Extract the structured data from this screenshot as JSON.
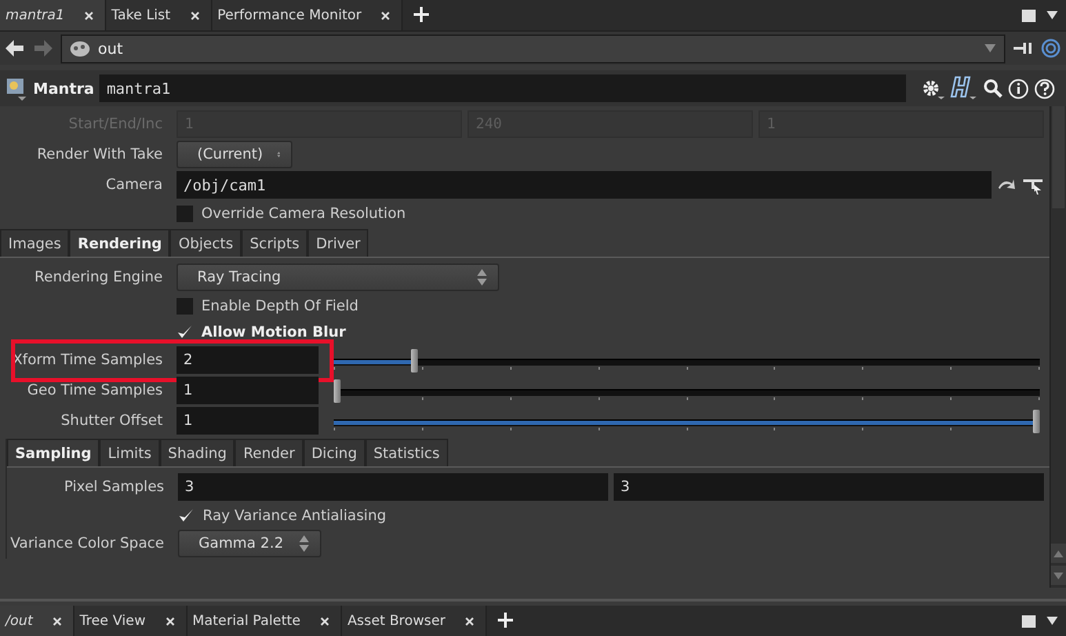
{
  "pane_tabs": [
    {
      "label": "mantra1",
      "selected": true
    },
    {
      "label": "Take List",
      "selected": false
    },
    {
      "label": "Performance Monitor",
      "selected": false
    }
  ],
  "path": {
    "value": "out"
  },
  "node": {
    "type": "Mantra",
    "name": "mantra1"
  },
  "top_parms": [
    {
      "kind": "triple",
      "label": "Start/End/Inc",
      "disabled": true,
      "values": [
        "1",
        "240",
        "1"
      ]
    },
    {
      "kind": "menu",
      "label": "Render With Take",
      "disabled": false,
      "value": "(Current)"
    },
    {
      "kind": "text",
      "label": "Camera",
      "disabled": false,
      "value": "/obj/cam1"
    },
    {
      "kind": "toggle",
      "label": "Override Camera Resolution",
      "disabled": false,
      "checked": false,
      "modified": false
    }
  ],
  "tabs": [
    {
      "label": "Images",
      "selected": false
    },
    {
      "label": "Rendering",
      "selected": true
    },
    {
      "label": "Objects",
      "selected": false
    },
    {
      "label": "Scripts",
      "selected": false
    },
    {
      "label": "Driver",
      "selected": false
    }
  ],
  "rendering_parms": [
    {
      "kind": "menu",
      "label": "Rendering Engine",
      "value": "Ray Tracing"
    },
    {
      "kind": "toggle",
      "label": "Enable Depth Of Field",
      "checked": false,
      "modified": false
    },
    {
      "kind": "toggle",
      "label": "Allow Motion Blur",
      "checked": true,
      "modified": true
    },
    {
      "kind": "slider",
      "label": "Xform Time Samples",
      "value": "2",
      "level": 0.11,
      "highlighted": true
    },
    {
      "kind": "slider",
      "label": "Geo Time Samples",
      "value": "1",
      "level": 0,
      "highlighted": false
    },
    {
      "kind": "slider",
      "label": "Shutter Offset",
      "value": "1",
      "level": 1,
      "highlighted": false
    }
  ],
  "sub_tabs": [
    {
      "label": "Sampling",
      "selected": true
    },
    {
      "label": "Limits",
      "selected": false
    },
    {
      "label": "Shading",
      "selected": false
    },
    {
      "label": "Render",
      "selected": false
    },
    {
      "label": "Dicing",
      "selected": false
    },
    {
      "label": "Statistics",
      "selected": false
    }
  ],
  "sampling_parms": [
    {
      "kind": "pair",
      "label": "Pixel Samples",
      "values": [
        "3",
        "3"
      ]
    },
    {
      "kind": "toggle",
      "label": "Ray Variance Antialiasing",
      "checked": true,
      "modified": false
    },
    {
      "kind": "menu",
      "label": "Variance Color Space",
      "value": "Gamma 2.2"
    }
  ],
  "bottom_tabs": [
    {
      "label": "/out",
      "selected": true
    },
    {
      "label": "Tree View",
      "selected": false
    },
    {
      "label": "Material Palette",
      "selected": false
    },
    {
      "label": "Asset Browser",
      "selected": false
    }
  ]
}
